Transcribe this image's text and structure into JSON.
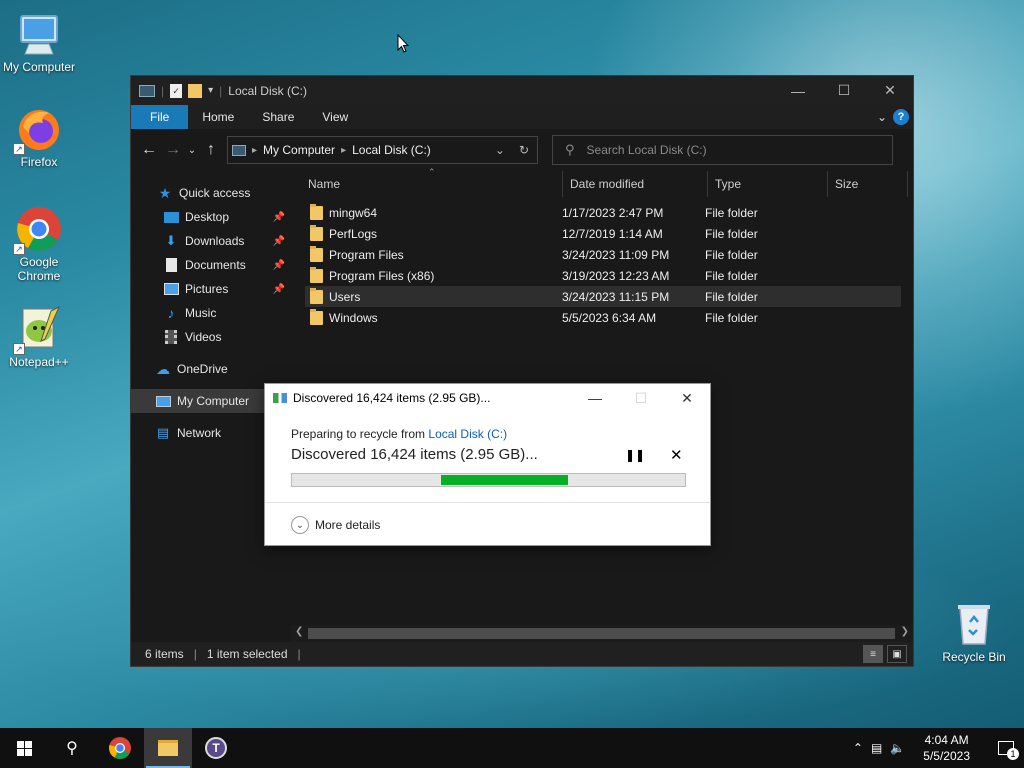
{
  "desktop": {
    "icons": [
      {
        "label": "My Computer"
      },
      {
        "label": "Firefox"
      },
      {
        "label": "Google Chrome"
      },
      {
        "label": "Notepad++"
      },
      {
        "label": "Recycle Bin"
      }
    ]
  },
  "explorer": {
    "title": "Local Disk (C:)",
    "ribbon_tabs": [
      "File",
      "Home",
      "Share",
      "View"
    ],
    "address": {
      "crumbs": [
        "My Computer",
        "Local Disk (C:)"
      ]
    },
    "search": {
      "placeholder": "Search Local Disk (C:)"
    },
    "nav": {
      "quick_access": "Quick access",
      "items": [
        "Desktop",
        "Downloads",
        "Documents",
        "Pictures",
        "Music",
        "Videos"
      ],
      "onedrive": "OneDrive",
      "my_computer": "My Computer",
      "network": "Network"
    },
    "columns": [
      "Name",
      "Date modified",
      "Type",
      "Size"
    ],
    "rows": [
      {
        "name": "mingw64",
        "date": "1/17/2023 2:47 PM",
        "type": "File folder"
      },
      {
        "name": "PerfLogs",
        "date": "12/7/2019 1:14 AM",
        "type": "File folder"
      },
      {
        "name": "Program Files",
        "date": "3/24/2023 11:09 PM",
        "type": "File folder"
      },
      {
        "name": "Program Files (x86)",
        "date": "3/19/2023 12:23 AM",
        "type": "File folder"
      },
      {
        "name": "Users",
        "date": "3/24/2023 11:15 PM",
        "type": "File folder"
      },
      {
        "name": "Windows",
        "date": "5/5/2023 6:34 AM",
        "type": "File folder"
      }
    ],
    "selected_row": 4,
    "status": {
      "count": "6 items",
      "selection": "1 item selected"
    }
  },
  "dialog": {
    "title": "Discovered 16,424 items (2.95 GB)...",
    "preparing_prefix": "Preparing to recycle from",
    "preparing_link": "Local Disk (C:)",
    "big_text": "Discovered 16,424 items (2.95 GB)...",
    "more_details": "More details",
    "progress": {
      "segment_start_fraction": 0.38,
      "segment_end_fraction": 0.703
    }
  },
  "taskbar": {
    "time": "4:04 AM",
    "date": "5/5/2023",
    "notification_count": "1"
  },
  "colors": {
    "accent": "#1a7ab8",
    "progress": "#06b025",
    "link": "#0a5fb4"
  }
}
